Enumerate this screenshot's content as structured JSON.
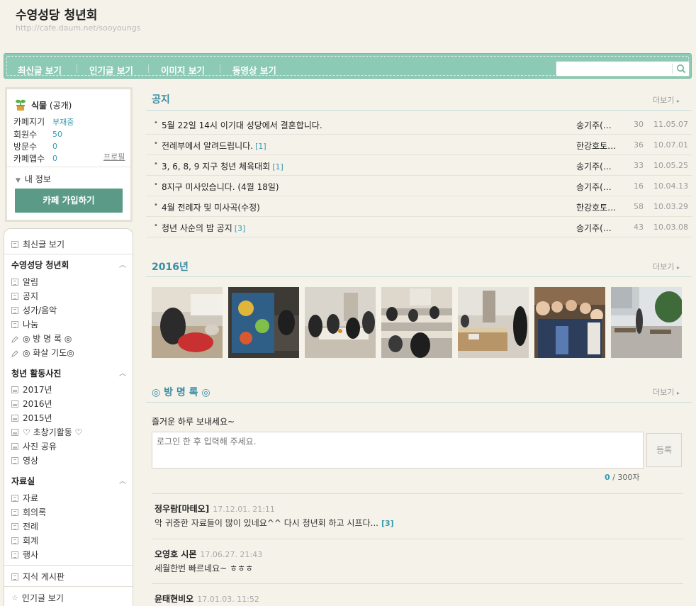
{
  "header": {
    "cafe_title": "수영성당 청년회",
    "cafe_url": "http://cafe.daum.net/sooyoungs"
  },
  "nav": {
    "items": [
      "최신글 보기",
      "인기글 보기",
      "이미지 보기",
      "동영상 보기"
    ],
    "search_placeholder": ""
  },
  "profile": {
    "level_name": "식물",
    "level_status": "(공개)",
    "stats": [
      {
        "label": "카페지기",
        "value": "부재중"
      },
      {
        "label": "회원수",
        "value": "50"
      },
      {
        "label": "방문수",
        "value": "0"
      },
      {
        "label": "카페앱수",
        "value": "0"
      }
    ],
    "profile_link": "프로필",
    "my_info": "내 정보",
    "join_button": "카페 가입하기"
  },
  "menu": {
    "recent": "최신글 보기",
    "group1_title": "수영성당 청년회",
    "group1_items": [
      "알림",
      "공지",
      "성가/음악",
      "나눔",
      "◎ 방 명 록 ◎",
      "◎ 화살 기도◎"
    ],
    "group2_title": "청년 활동사진",
    "group2_items": [
      "2017년",
      "2016년",
      "2015년",
      "♡ 초창기활동 ♡",
      "사진 공유",
      "영상"
    ],
    "group3_title": "자료실",
    "group3_items": [
      "자료",
      "회의록",
      "전례",
      "회계",
      "행사"
    ],
    "knowledge": "지식 게시판",
    "popular": "인기글 보기"
  },
  "notice": {
    "title": "공지",
    "more": "더보기",
    "rows": [
      {
        "title": "5월 22일 14시 이기대 성당에서 결혼합니다.",
        "count": "",
        "author": "송기주(…",
        "views": "30",
        "date": "11.05.07"
      },
      {
        "title": "전례부에서 알려드립니다.",
        "count": "[1]",
        "author": "한강호토…",
        "views": "36",
        "date": "10.07.01"
      },
      {
        "title": "3, 6, 8, 9 지구 청년 체육대회",
        "count": "[1]",
        "author": "송기주(…",
        "views": "33",
        "date": "10.05.25"
      },
      {
        "title": "8지구 미사있습니다. (4월 18일)",
        "count": "",
        "author": "송기주(…",
        "views": "16",
        "date": "10.04.13"
      },
      {
        "title": "4월 전례자 및 미사곡(수정)",
        "count": "",
        "author": "한강호토…",
        "views": "58",
        "date": "10.03.29"
      },
      {
        "title": "청년 사순의 밤 공지",
        "count": "[3]",
        "author": "송기주(…",
        "views": "43",
        "date": "10.03.08"
      }
    ]
  },
  "gallery": {
    "title": "2016년",
    "more": "더보기"
  },
  "guestbook": {
    "title": "◎ 방 명 록 ◎",
    "more": "더보기",
    "greeting": "즐거운 하루 보내세요~",
    "input_placeholder": "로그인 한 후 입력해 주세요.",
    "submit": "등록",
    "counter_current": "0",
    "counter_max": "/ 300자",
    "entries": [
      {
        "author": "정우람[마테오]",
        "date": "17.12.01. 21:11",
        "text": "악 귀중한 자료들이 많이 있네요^^ 다시 청년회 하고 시프다...",
        "reply": "[3]"
      },
      {
        "author": "오영호 시몬",
        "date": "17.06.27. 21:43",
        "text": "세월한번 빠르네요~ ㅎㅎㅎ",
        "reply": ""
      },
      {
        "author": "윤태현비오",
        "date": "17.01.03. 11:52",
        "text": "",
        "reply": ""
      }
    ]
  },
  "colors": {
    "nav_bg": "#8ccab5",
    "accent": "#3a8ca5",
    "link": "#3a9ab0",
    "join_bg": "#5a9a86"
  }
}
